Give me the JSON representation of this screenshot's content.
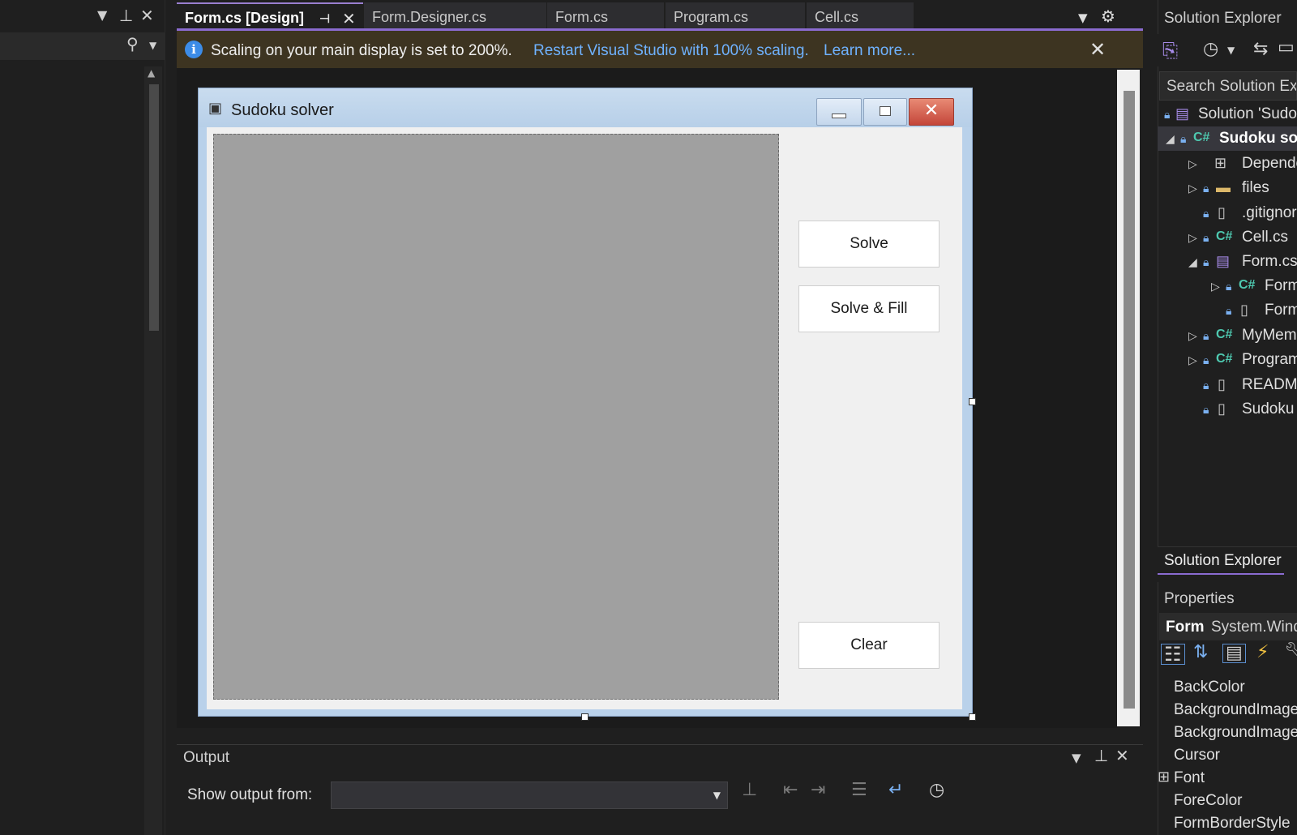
{
  "tabs": [
    {
      "label": "Form.cs [Design]",
      "active": true
    },
    {
      "label": "Form.Designer.cs",
      "active": false
    },
    {
      "label": "Form.cs",
      "active": false
    },
    {
      "label": "Program.cs",
      "active": false
    },
    {
      "label": "Cell.cs",
      "active": false
    }
  ],
  "info_bar": {
    "message": "Scaling on your main display is set to 200%.",
    "restart_link": "Restart Visual Studio with 100% scaling.",
    "learn_more_link": "Learn more...",
    "icon_glyph": "i"
  },
  "form": {
    "title": "Sudoku solver",
    "buttons": {
      "solve": "Solve",
      "solve_fill": "Solve & Fill",
      "clear": "Clear"
    }
  },
  "output": {
    "title": "Output",
    "show_output_from_label": "Show output from:",
    "selected_source": ""
  },
  "solution_explorer": {
    "title": "Solution Explorer",
    "search_placeholder": "Search Solution Exp",
    "tab_label": "Solution Explorer",
    "tree": [
      {
        "label": "Solution 'Sudoku"
      },
      {
        "label": "Sudoku so"
      },
      {
        "label": "Dependencies"
      },
      {
        "label": "files"
      },
      {
        "label": ".gitignore"
      },
      {
        "label": "Cell.cs"
      },
      {
        "label": "Form.cs"
      },
      {
        "label": "Form"
      },
      {
        "label": "Form"
      },
      {
        "label": "MyMem"
      },
      {
        "label": "Program"
      },
      {
        "label": "README"
      },
      {
        "label": "Sudoku"
      }
    ]
  },
  "properties": {
    "title": "Properties",
    "object_name": "Form",
    "object_type": "System.Wind",
    "rows": [
      {
        "name": "BackColor"
      },
      {
        "name": "BackgroundImage"
      },
      {
        "name": "BackgroundImage"
      },
      {
        "name": "Cursor"
      },
      {
        "name": "Font"
      },
      {
        "name": "ForeColor"
      },
      {
        "name": "FormBorderStyle"
      }
    ]
  },
  "colors": {
    "accent": "#8a6bd0",
    "info_link": "#6fb2ff",
    "close_button": "#c4463a"
  }
}
